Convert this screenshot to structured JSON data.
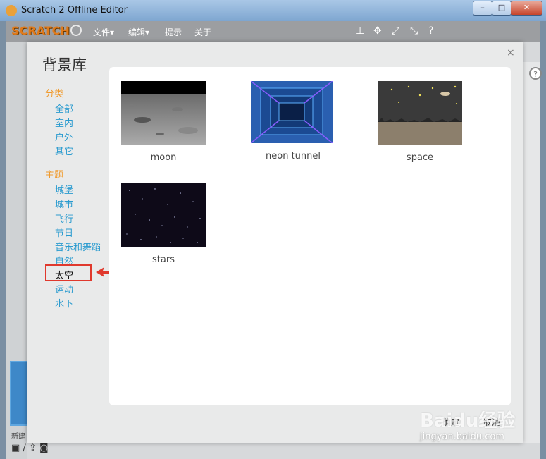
{
  "window": {
    "title": "Scratch 2 Offline Editor",
    "min": "–",
    "max": "□",
    "close": "✕"
  },
  "menubar": {
    "logo": "SCRATCH",
    "items": [
      "文件▾",
      "编辑▾",
      "提示",
      "关于"
    ],
    "tools": [
      "stamp-icon",
      "grow-icon",
      "shrink-icon",
      "help-icon"
    ]
  },
  "dialog": {
    "title": "背景库",
    "close": "×",
    "category_head": "分类",
    "categories": [
      "全部",
      "室内",
      "户外",
      "其它"
    ],
    "theme_head": "主题",
    "themes": [
      "城堡",
      "城市",
      "飞行",
      "节日",
      "音乐和舞蹈",
      "自然",
      "太空",
      "运动",
      "水下"
    ],
    "selected_theme": "太空",
    "items": [
      {
        "label": "moon"
      },
      {
        "label": "neon tunnel"
      },
      {
        "label": "space"
      },
      {
        "label": "stars"
      }
    ],
    "ok": "确定",
    "cancel": "取消"
  },
  "left_pane": {
    "new_label": "新建",
    "icons": "▣ ∕ ⇪ ◙"
  },
  "help": "?",
  "watermark": {
    "logo": "Baidu经验",
    "url": "jingyan.baidu.com"
  },
  "colors": {
    "category_head": "#f09a2c",
    "link": "#2a9bcf",
    "highlight": "#e0392d"
  }
}
